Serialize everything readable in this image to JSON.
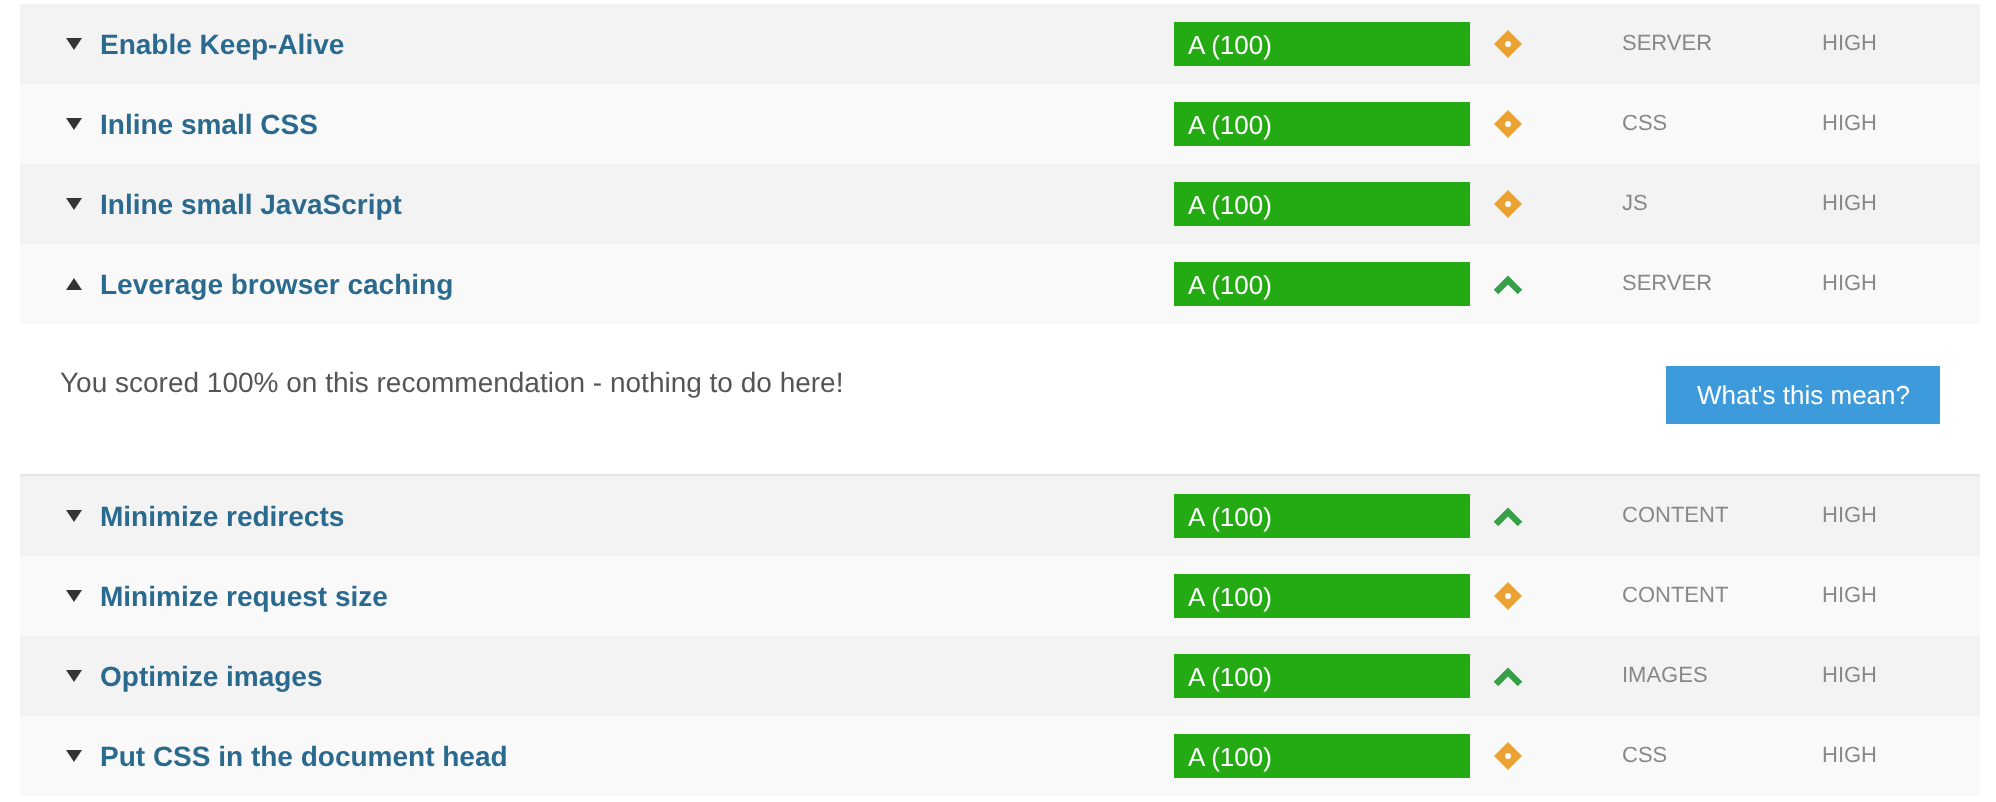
{
  "rules": [
    {
      "name": "Enable Keep-Alive",
      "expanded": false,
      "grade": "A (100)",
      "kind": "neutral",
      "type": "SERVER",
      "priority": "HIGH"
    },
    {
      "name": "Inline small CSS",
      "expanded": false,
      "grade": "A (100)",
      "kind": "neutral",
      "type": "CSS",
      "priority": "HIGH"
    },
    {
      "name": "Inline small JavaScript",
      "expanded": false,
      "grade": "A (100)",
      "kind": "neutral",
      "type": "JS",
      "priority": "HIGH"
    },
    {
      "name": "Leverage browser caching",
      "expanded": true,
      "grade": "A (100)",
      "kind": "up",
      "type": "SERVER",
      "priority": "HIGH",
      "details": {
        "message": "You scored 100% on this recommendation - nothing to do here!",
        "button": "What's this mean?"
      }
    },
    {
      "name": "Minimize redirects",
      "expanded": false,
      "grade": "A (100)",
      "kind": "up",
      "type": "CONTENT",
      "priority": "HIGH"
    },
    {
      "name": "Minimize request size",
      "expanded": false,
      "grade": "A (100)",
      "kind": "neutral",
      "type": "CONTENT",
      "priority": "HIGH"
    },
    {
      "name": "Optimize images",
      "expanded": false,
      "grade": "A (100)",
      "kind": "up",
      "type": "IMAGES",
      "priority": "HIGH"
    },
    {
      "name": "Put CSS in the document head",
      "expanded": false,
      "grade": "A (100)",
      "kind": "neutral",
      "type": "CSS",
      "priority": "HIGH"
    }
  ]
}
